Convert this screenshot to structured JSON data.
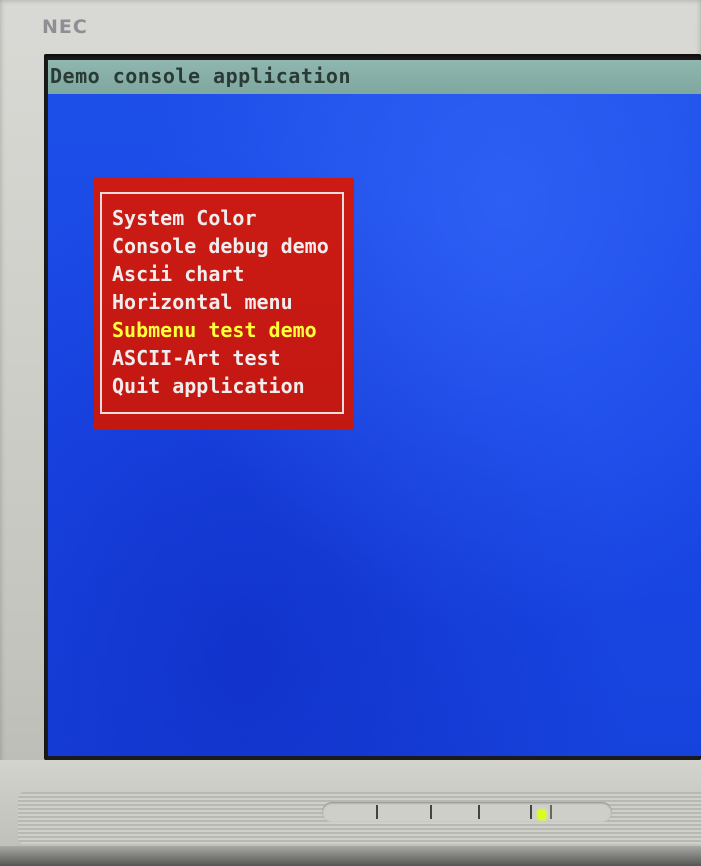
{
  "monitor": {
    "brand": "NEC",
    "buttons": [
      {
        "icon": "select-button-icon"
      },
      {
        "icon": "minus-button-icon"
      },
      {
        "icon": "plus-button-icon"
      },
      {
        "icon": "auto-button-icon"
      },
      {
        "icon": "power-button-icon"
      }
    ],
    "power_led_color": "#d8ff1a"
  },
  "console": {
    "title": "Demo console application",
    "background_color": "#1a48e6",
    "titlebar_color": "#8fb7b0",
    "menu": {
      "background_color": "#c31812",
      "text_color": "#f2ecec",
      "selected_color": "#ffff3a",
      "items": [
        {
          "label": "System Color",
          "selected": false
        },
        {
          "label": "Console debug demo",
          "selected": false
        },
        {
          "label": "Ascii chart",
          "selected": false
        },
        {
          "label": "Horizontal menu",
          "selected": false
        },
        {
          "label": "Submenu test demo",
          "selected": true
        },
        {
          "label": "ASCII-Art test",
          "selected": false
        },
        {
          "label": "Quit application",
          "selected": false
        }
      ]
    }
  }
}
